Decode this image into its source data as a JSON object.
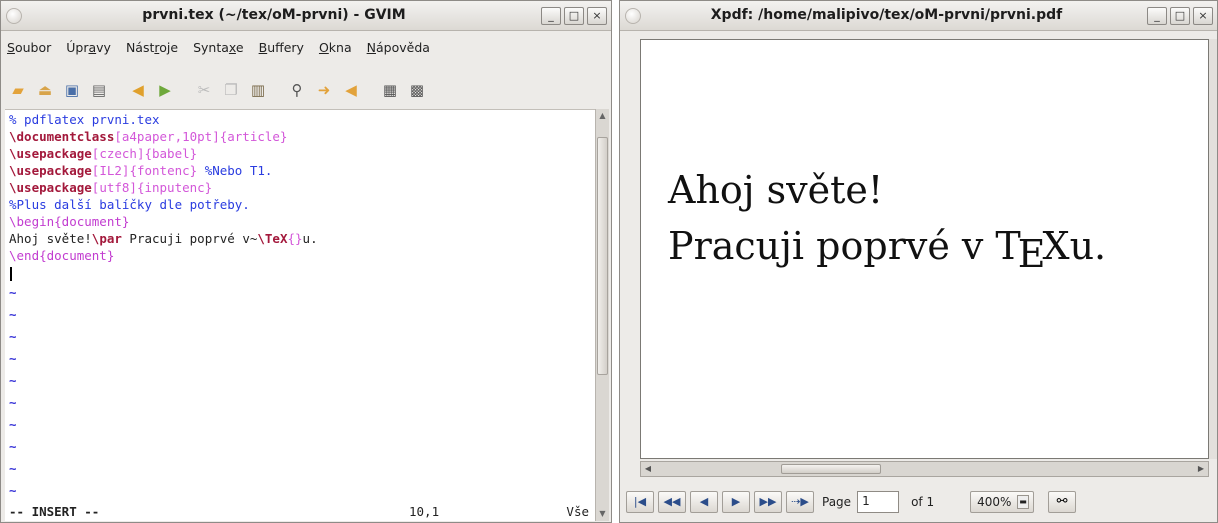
{
  "gvim": {
    "title": "prvni.tex (~/tex/oM-prvni) - GVIM",
    "window_buttons": [
      "_",
      "□",
      "×"
    ],
    "menu": [
      {
        "mnemonic": "S",
        "rest": "oubor"
      },
      {
        "pre": "Úpr",
        "mnemonic": "a",
        "rest": "vy"
      },
      {
        "pre": "Nást",
        "mnemonic": "r",
        "rest": "oje"
      },
      {
        "pre": "Synta",
        "mnemonic": "x",
        "rest": "e"
      },
      {
        "mnemonic": "B",
        "rest": "uffery"
      },
      {
        "mnemonic": "O",
        "rest": "kna"
      },
      {
        "mnemonic": "N",
        "rest": "ápověda"
      }
    ],
    "toolbar_icons": [
      "open-folder-icon",
      "save-session-icon",
      "save-icon",
      "print-icon",
      "undo-icon",
      "redo-icon",
      "cut-icon",
      "copy-icon",
      "paste-icon",
      "find-replace-icon",
      "find-next-icon",
      "find-prev-icon",
      "load-session-icon",
      "make-icon"
    ],
    "editor": {
      "l1": "% pdflatex prvni.tex",
      "l2_cmd": "\\documentclass",
      "l2_opt": "[a4paper,10pt]",
      "l2_arg": "{article}",
      "l3_cmd": "\\usepackage",
      "l3_opt": "[czech]",
      "l3_arg": "{babel}",
      "l4_cmd": "\\usepackage",
      "l4_opt": "[IL2]",
      "l4_arg": "{fontenc}",
      "l4_comment": " %Nebo T1.",
      "l5_cmd": "\\usepackage",
      "l5_opt": "[utf8]",
      "l5_arg": "{inputenc}",
      "l6": "%Plus další balíčky dle potřeby.",
      "l7": "\\begin{document}",
      "l8_text": "Ahoj světe!",
      "l8_par": "\\par",
      "l8_mid": " Pracuji poprvé v~",
      "l8_tex": "\\TeX",
      "l8_brace": "{}",
      "l8_end": "u.",
      "l9": "\\end{document}",
      "tilde": "~"
    },
    "status": {
      "mode": "-- INSERT --",
      "position": "10,1",
      "percent": "Vše"
    }
  },
  "xpdf": {
    "title": "Xpdf: /home/malipivo/tex/oM-prvni/prvni.pdf",
    "window_buttons": [
      "_",
      "□",
      "×"
    ],
    "document": {
      "line1": "Ahoj světe!",
      "line2_before": "Pracuji poprvé v T",
      "line2_e": "E",
      "line2_after": "Xu."
    },
    "toolbar": {
      "page_label": "Page",
      "page_value": "1",
      "of_label": "of 1",
      "zoom": "400%"
    }
  }
}
